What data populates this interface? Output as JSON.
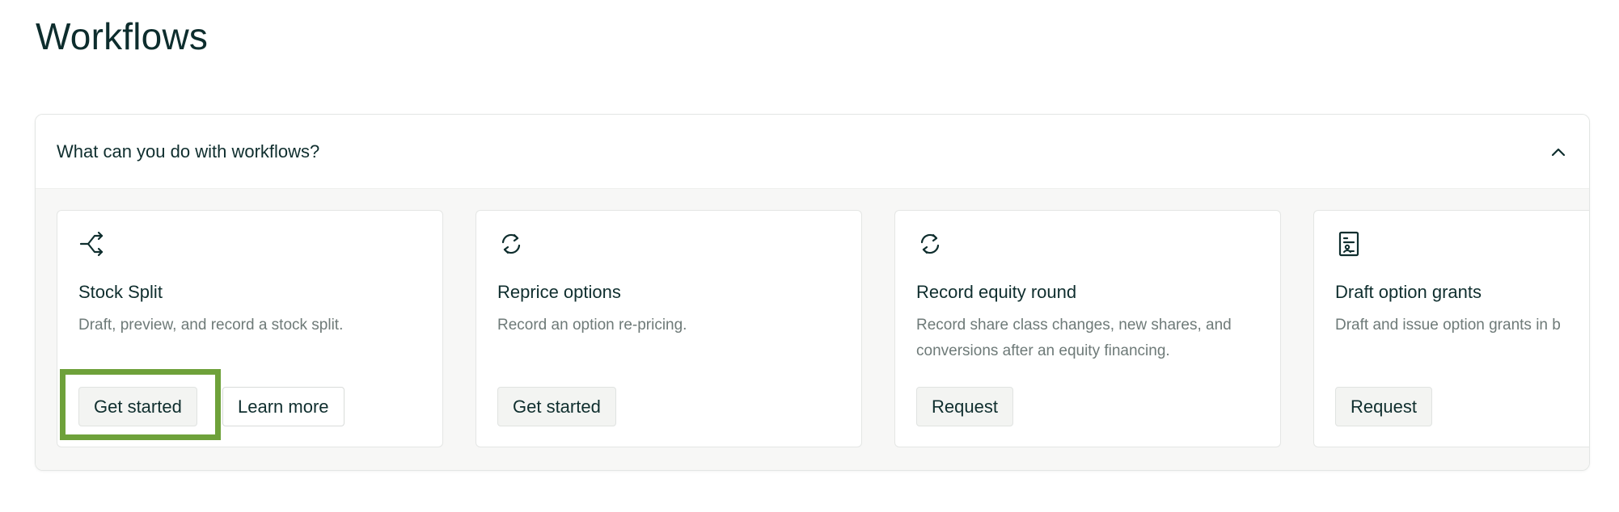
{
  "page": {
    "title": "Workflows"
  },
  "panel": {
    "header_title": "What can you do with workflows?",
    "collapse_icon": "chevron-up-icon"
  },
  "cards": [
    {
      "icon": "split-arrows-icon",
      "title": "Stock Split",
      "description": "Draft, preview, and record a stock split.",
      "primary_label": "Get started",
      "secondary_label": "Learn more"
    },
    {
      "icon": "refresh-icon",
      "title": "Reprice options",
      "description": "Record an option re-pricing.",
      "primary_label": "Get started"
    },
    {
      "icon": "refresh-icon",
      "title": "Record equity round",
      "description": "Record share class changes, new shares, and conversions after an equity financing.",
      "primary_label": "Request"
    },
    {
      "icon": "document-certificate-icon",
      "title": "Draft option grants",
      "description": "Draft and issue option grants in b",
      "primary_label": "Request"
    }
  ],
  "colors": {
    "highlight": "#6ea13a",
    "text": "#0f2e2e",
    "muted_text": "#6e7a78"
  }
}
